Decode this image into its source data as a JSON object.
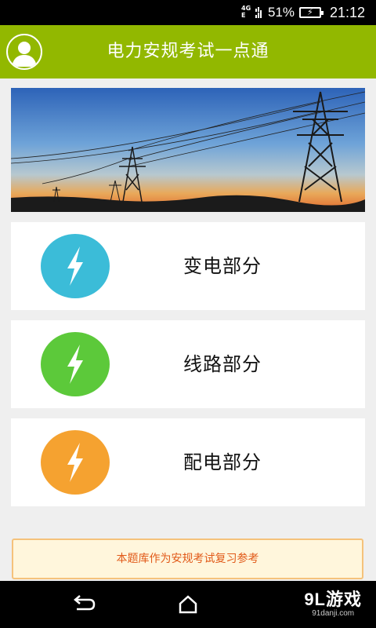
{
  "status_bar": {
    "network_top": "4G",
    "network_bottom": "E",
    "battery_percent": "51%",
    "time": "21:12",
    "icons": [
      "network-icon",
      "signal-icon",
      "battery-charging-icon"
    ]
  },
  "app_bar": {
    "title": "电力安规考试一点通",
    "avatar_icon": "user-avatar-icon",
    "color": "#92b800"
  },
  "banner": {
    "image": "power-transmission-towers-sunset"
  },
  "categories": [
    {
      "label": "变电部分",
      "color": "#3bbcd8",
      "icon": "lightning-bolt-icon"
    },
    {
      "label": "线路部分",
      "color": "#5cc93a",
      "icon": "lightning-bolt-icon"
    },
    {
      "label": "配电部分",
      "color": "#f5a230",
      "icon": "lightning-bolt-icon"
    }
  ],
  "notice": {
    "text": "本题库作为安规考试复习参考",
    "text_color": "#e15a19",
    "background": "#fff6dc"
  },
  "nav_bar": {
    "buttons": [
      "back-icon",
      "home-icon"
    ],
    "watermark_main": "9L游戏",
    "watermark_sub": "91danji.com"
  }
}
